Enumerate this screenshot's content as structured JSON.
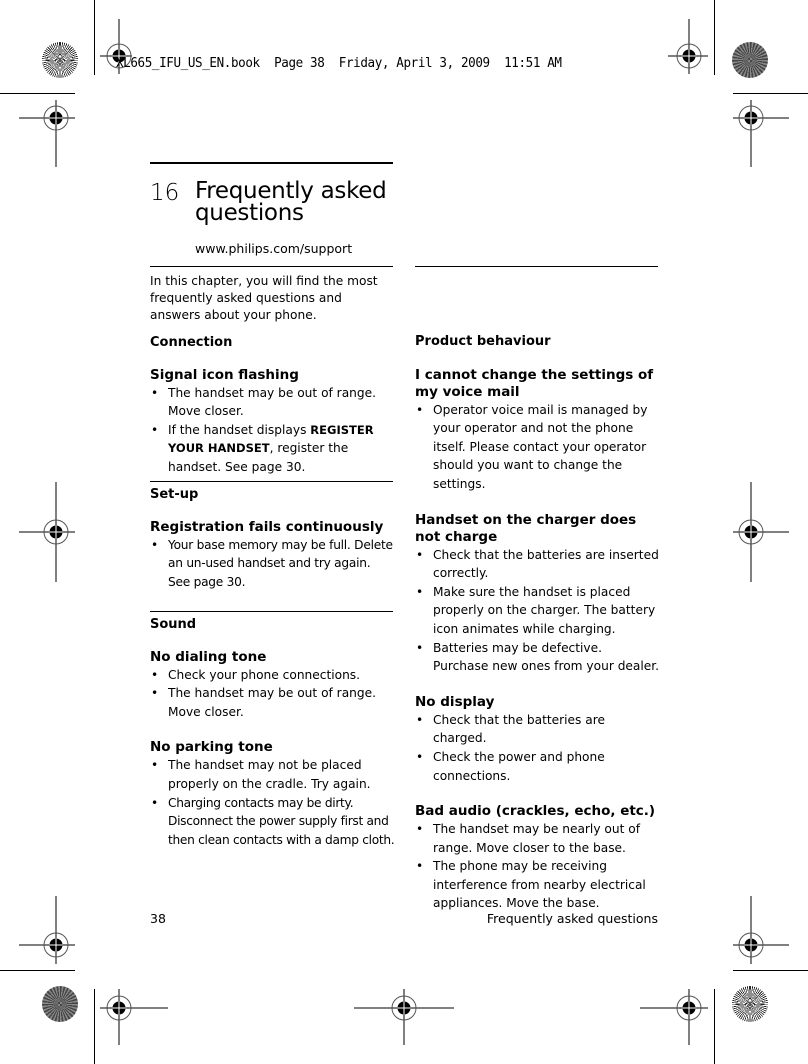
{
  "slug": "XL665_IFU_US_EN.book  Page 38  Friday, April 3, 2009  11:51 AM",
  "chapter": {
    "number": "16",
    "title_line1": "Frequently asked",
    "title_line2": "questions",
    "url": "www.philips.com/support",
    "intro": "In this chapter, you will find the most frequently asked questions and answers about your phone."
  },
  "left_column": {
    "connection": {
      "heading": "Connection",
      "q1": {
        "title": "Signal icon flashing",
        "b1": "The handset may be out of range. Move closer.",
        "b2_pre": "If the handset displays ",
        "b2_bold": "REGISTER YOUR HANDSET",
        "b2_post": ", register the handset. See page 30."
      }
    },
    "setup": {
      "heading": "Set-up",
      "q1": {
        "title": "Registration fails continuously",
        "b1": "Your base memory may be full. Delete an un-used handset and try again. See page 30."
      }
    },
    "sound": {
      "heading": "Sound",
      "q1": {
        "title": "No dialing tone",
        "b1": "Check your phone connections.",
        "b2": "The handset may be out of range. Move closer."
      },
      "q2": {
        "title": "No parking tone",
        "b1": "The handset may not be placed properly on the cradle. Try again.",
        "b2": "Charging contacts may be dirty. Disconnect the power supply first and then clean contacts with a damp cloth."
      }
    }
  },
  "right_column": {
    "heading": "Product behaviour",
    "q1": {
      "title": "I cannot change the settings of my voice mail",
      "b1": "Operator voice mail is managed by your operator and not the phone itself.  Please contact your operator should you want to change the settings."
    },
    "q2": {
      "title": "Handset on the charger does not charge",
      "b1": "Check that the batteries are inserted correctly.",
      "b2": "Make sure the handset is placed properly on the charger. The battery icon animates while charging.",
      "b3": "Batteries may be defective. Purchase new ones from your dealer."
    },
    "q3": {
      "title": "No display",
      "b1": "Check that the batteries are charged.",
      "b2": "Check the power and phone connections."
    },
    "q4": {
      "title": "Bad audio (crackles, echo, etc.)",
      "b1": "The handset may be nearly out of range. Move closer to the base.",
      "b2": "The phone may be receiving interference from nearby electrical appliances. Move the base."
    }
  },
  "footer": {
    "page_number": "38",
    "section_title": "Frequently asked questions"
  }
}
